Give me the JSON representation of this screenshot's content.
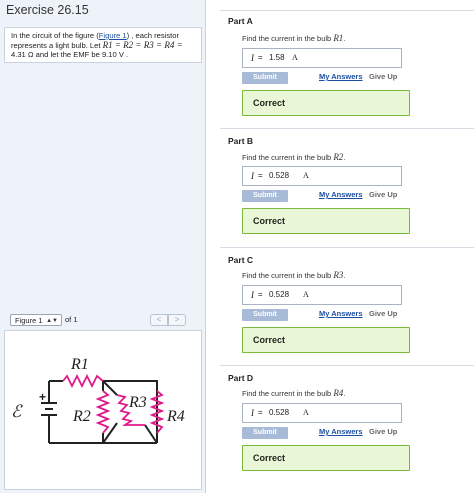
{
  "exercise_title": "Exercise 26.15",
  "problem": {
    "text_before_link": "In the circuit of the figure (",
    "figure_link": "Figure 1",
    "text_after_link": ") , each resistor represents a light bulb. Let ",
    "equality": "R1 = R2 = R3 = R4 =",
    "line3": "4.31 Ω and let the EMF be 9.10 V ."
  },
  "figure_nav": {
    "select_value": "Figure 1",
    "of_text": "of 1",
    "prev": "<",
    "next": ">"
  },
  "circuit": {
    "emf_label": "ℰ",
    "plus": "+",
    "labels": [
      "R1",
      "R2",
      "R3",
      "R4"
    ],
    "wire_color": "#222222",
    "resistor_color": "#e0198a"
  },
  "parts": [
    {
      "title": "Part A",
      "question_pre": "Find the current in the bulb ",
      "bulb": "R1",
      "var": "I",
      "eq": "=",
      "value": "1.58",
      "unit": "A",
      "submit": "Submit",
      "my_answers": "My Answers",
      "give_up": "Give Up",
      "result": "Correct"
    },
    {
      "title": "Part B",
      "question_pre": "Find the current in the bulb ",
      "bulb": "R2",
      "var": "I",
      "eq": "=",
      "value": "0.528",
      "unit": "A",
      "submit": "Submit",
      "my_answers": "My Answers",
      "give_up": "Give Up",
      "result": "Correct"
    },
    {
      "title": "Part C",
      "question_pre": "Find the current in the bulb ",
      "bulb": "R3",
      "var": "I",
      "eq": "=",
      "value": "0.528",
      "unit": "A",
      "submit": "Submit",
      "my_answers": "My Answers",
      "give_up": "Give Up",
      "result": "Correct"
    },
    {
      "title": "Part D",
      "question_pre": "Find the current in the bulb ",
      "bulb": "R4",
      "var": "I",
      "eq": "=",
      "value": "0.528",
      "unit": "A",
      "submit": "Submit",
      "my_answers": "My Answers",
      "give_up": "Give Up",
      "result": "Correct"
    }
  ],
  "colors": {
    "correct_bg": "#eaf7d6",
    "correct_border": "#79b93b",
    "submit_bg": "#a7bbd8",
    "link": "#1a4fa0"
  }
}
